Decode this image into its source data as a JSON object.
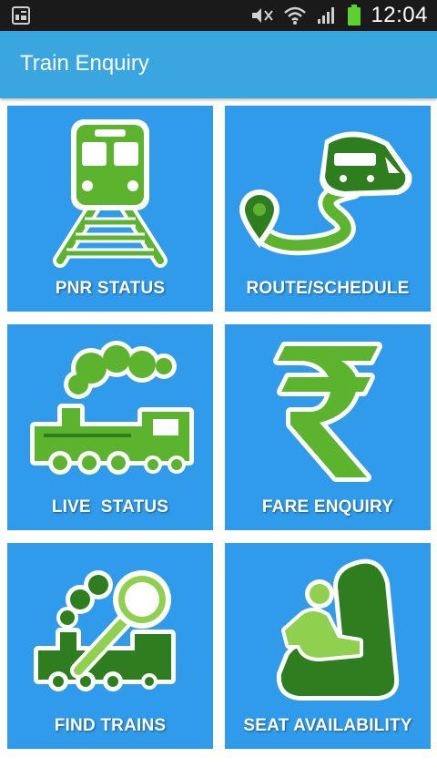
{
  "status_bar": {
    "time": "12:04",
    "icons": [
      "screenshot-icon",
      "mute-icon",
      "wifi-icon",
      "signal-icon",
      "battery-icon"
    ]
  },
  "app_bar": {
    "title": "Train Enquiry"
  },
  "tiles": [
    {
      "label": "PNR STATUS",
      "icon": "train-track-icon"
    },
    {
      "label": "ROUTE/SCHEDULE",
      "icon": "route-train-icon"
    },
    {
      "label": "LIVE  STATUS",
      "icon": "steam-locomotive-icon"
    },
    {
      "label": "FARE ENQUIRY",
      "icon": "rupee-icon"
    },
    {
      "label": "FIND TRAINS",
      "icon": "train-search-icon"
    },
    {
      "label": "SEAT AVAILABILITY",
      "icon": "seat-icon"
    }
  ],
  "colors": {
    "tile_background": "#2f9bea",
    "app_bar": "#3aa6e0",
    "icon_green": "#5cb32e",
    "icon_dark_green": "#2e7d1f",
    "status_bar": "#1a1a1a"
  }
}
